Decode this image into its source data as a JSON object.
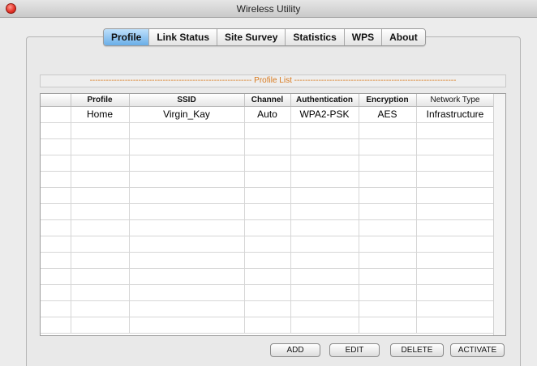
{
  "window": {
    "title": "Wireless Utility"
  },
  "tabs": [
    {
      "label": "Profile",
      "active": true
    },
    {
      "label": "Link Status",
      "active": false
    },
    {
      "label": "Site Survey",
      "active": false
    },
    {
      "label": "Statistics",
      "active": false
    },
    {
      "label": "WPS",
      "active": false
    },
    {
      "label": "About",
      "active": false
    }
  ],
  "profile_list": {
    "label": "Profile List"
  },
  "table": {
    "columns": [
      "",
      "Profile",
      "SSID",
      "Channel",
      "Authentication",
      "Encryption",
      "Network Type"
    ],
    "rows": [
      [
        "",
        "Home",
        "Virgin_Kay",
        "Auto",
        "WPA2-PSK",
        "AES",
        "Infrastructure"
      ]
    ]
  },
  "buttons": {
    "add": "ADD",
    "edit": "EDIT",
    "delete": "DELETE",
    "activate": "ACTIVATE"
  },
  "colors": {
    "active_tab": "#6aaee8",
    "profile_list_label": "#d97a1e",
    "close_button": "#e6352b"
  }
}
